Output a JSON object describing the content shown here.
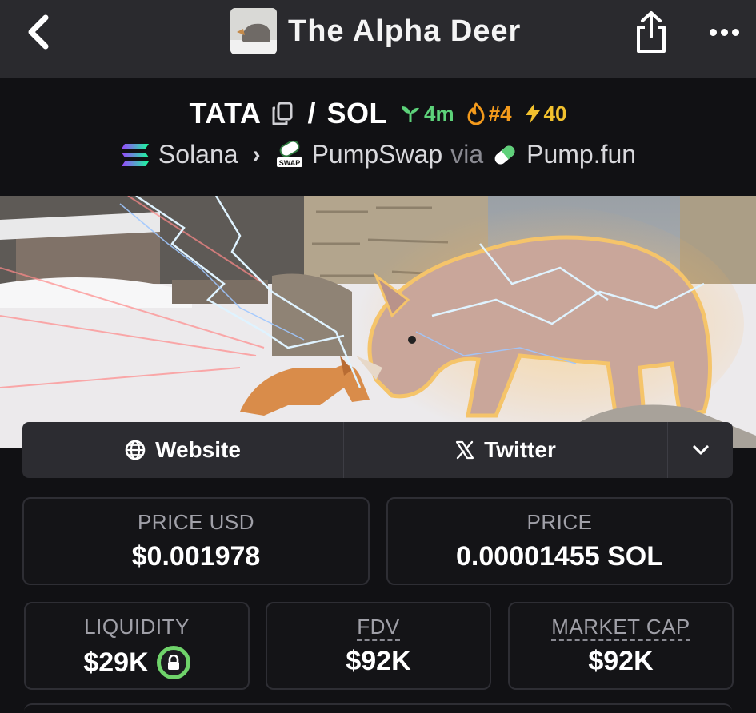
{
  "window": {
    "title": "The Alpha Deer"
  },
  "icons": {
    "back": "chevron-left-icon",
    "share": "share-icon",
    "more": "more-dots-icon",
    "copy": "copy-icon",
    "sprout": "sprout-icon",
    "flame": "flame-icon",
    "bolt": "lightning-icon",
    "globe": "globe-icon",
    "x": "x-logo-icon",
    "dropdown": "chevron-down-icon"
  },
  "pair": {
    "base": "TATA",
    "quote": "SOL",
    "age": "4m",
    "rank": "#4",
    "boosts": "40"
  },
  "route": {
    "chain": "Solana",
    "dex": "PumpSwap",
    "via_label": "via",
    "launchpad": "Pump.fun"
  },
  "links": {
    "website": "Website",
    "twitter": "Twitter"
  },
  "stats": {
    "price_usd": {
      "label": "PRICE USD",
      "value": "$0.001978"
    },
    "price": {
      "label": "PRICE",
      "value": "0.00001455 SOL"
    },
    "liquidity": {
      "label": "LIQUIDITY",
      "value": "$29K"
    },
    "fdv": {
      "label": "FDV",
      "value": "$92K"
    },
    "market_cap": {
      "label": "MARKET CAP",
      "value": "$92K"
    }
  },
  "colors": {
    "age_green": "#5dd27a",
    "rank_orange": "#f39a1c",
    "boost_yellow": "#f2c12e",
    "lock_green": "#6fd36a"
  }
}
